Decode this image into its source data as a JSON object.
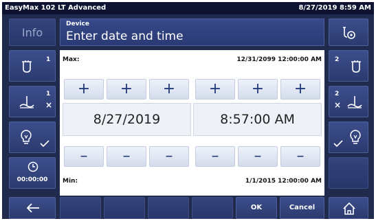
{
  "titlebar": {
    "app_name": "EasyMax 102 LT Advanced",
    "datetime": "8/27/2019 8:59 AM"
  },
  "header": {
    "info_label": "Info",
    "section": "Device",
    "title": "Enter date and time"
  },
  "left_buttons": {
    "reactor_badge": "1",
    "stirrer_badge_top": "1",
    "stirrer_badge_bottom": "×",
    "timer_value": "00:00:00"
  },
  "right_buttons": {
    "reactor_badge": "2",
    "stirrer_badge_top": "2",
    "stirrer_badge_bottom": "×"
  },
  "panel": {
    "max_label": "Max:",
    "max_value": "12/31/2099 12:00:00 AM",
    "min_label": "Min:",
    "min_value": "1/1/2015 12:00:00 AM",
    "date_value": "8/27/2019",
    "time_value": "8:57:00 AM",
    "plus_symbol": "+",
    "minus_symbol": "–"
  },
  "bottom_bar": {
    "ok_label": "OK",
    "cancel_label": "Cancel"
  },
  "colors": {
    "background": "#1f2a4d",
    "button": "#34447c",
    "titlebar": "#0d1330"
  }
}
